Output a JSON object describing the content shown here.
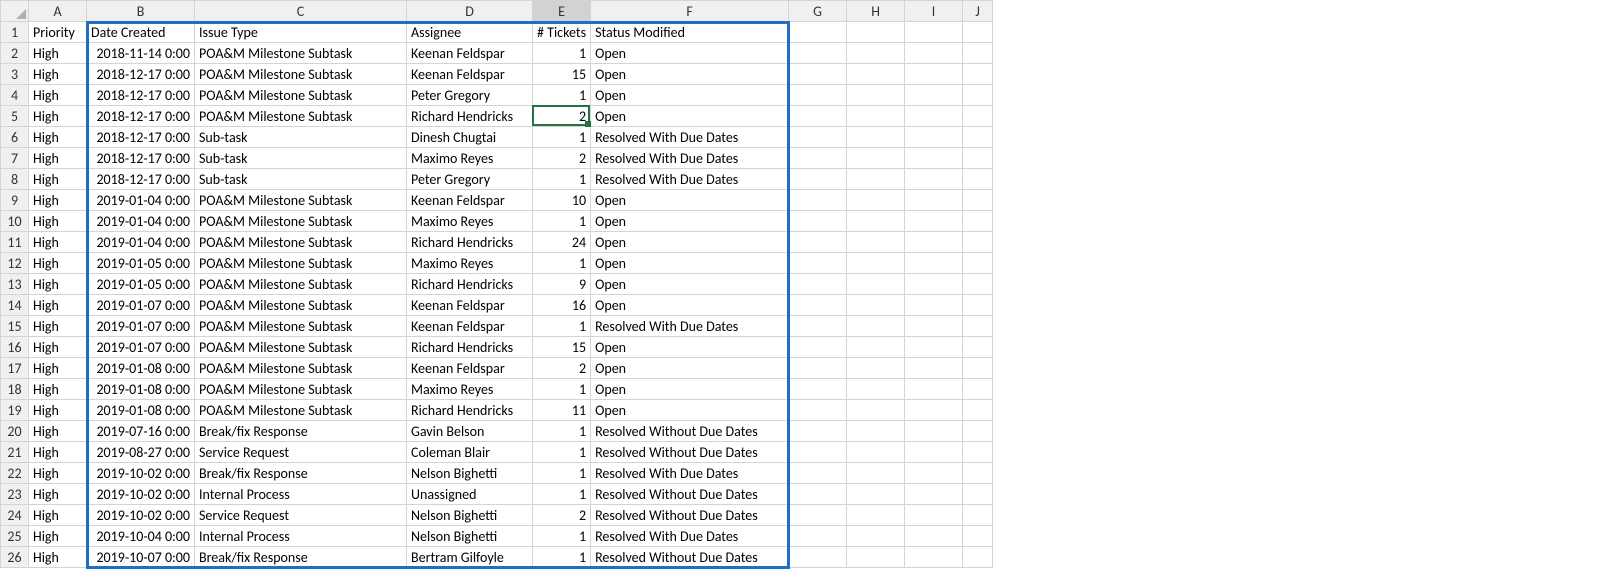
{
  "corner_label": "",
  "col_headers": [
    "A",
    "B",
    "C",
    "D",
    "E",
    "F",
    "G",
    "H",
    "I",
    "J"
  ],
  "row_headers": [
    "1",
    "2",
    "3",
    "4",
    "5",
    "6",
    "7",
    "8",
    "9",
    "10",
    "11",
    "12",
    "13",
    "14",
    "15",
    "16",
    "17",
    "18",
    "19",
    "20",
    "21",
    "22",
    "23",
    "24",
    "25",
    "26"
  ],
  "headers": {
    "priority": "Priority",
    "date_created": "Date Created",
    "issue_type": "Issue Type",
    "assignee": "Assignee",
    "tickets": "# Tickets",
    "status": "Status Modified"
  },
  "rows": [
    {
      "priority": "High",
      "date": "2018-11-14 0:00",
      "type": "POA&M Milestone Subtask",
      "assignee": "Keenan Feldspar",
      "tickets": "1",
      "status": "Open"
    },
    {
      "priority": "High",
      "date": "2018-12-17 0:00",
      "type": "POA&M Milestone Subtask",
      "assignee": "Keenan Feldspar",
      "tickets": "15",
      "status": "Open"
    },
    {
      "priority": "High",
      "date": "2018-12-17 0:00",
      "type": "POA&M Milestone Subtask",
      "assignee": "Peter Gregory",
      "tickets": "1",
      "status": "Open"
    },
    {
      "priority": "High",
      "date": "2018-12-17 0:00",
      "type": "POA&M Milestone Subtask",
      "assignee": "Richard Hendricks",
      "tickets": "2",
      "status": "Open"
    },
    {
      "priority": "High",
      "date": "2018-12-17 0:00",
      "type": "Sub-task",
      "assignee": "Dinesh Chugtai",
      "tickets": "1",
      "status": "Resolved With Due Dates"
    },
    {
      "priority": "High",
      "date": "2018-12-17 0:00",
      "type": "Sub-task",
      "assignee": "Maximo Reyes",
      "tickets": "2",
      "status": "Resolved With Due Dates"
    },
    {
      "priority": "High",
      "date": "2018-12-17 0:00",
      "type": "Sub-task",
      "assignee": "Peter Gregory",
      "tickets": "1",
      "status": "Resolved With Due Dates"
    },
    {
      "priority": "High",
      "date": "2019-01-04 0:00",
      "type": "POA&M Milestone Subtask",
      "assignee": "Keenan Feldspar",
      "tickets": "10",
      "status": "Open"
    },
    {
      "priority": "High",
      "date": "2019-01-04 0:00",
      "type": "POA&M Milestone Subtask",
      "assignee": "Maximo Reyes",
      "tickets": "1",
      "status": "Open"
    },
    {
      "priority": "High",
      "date": "2019-01-04 0:00",
      "type": "POA&M Milestone Subtask",
      "assignee": "Richard Hendricks",
      "tickets": "24",
      "status": "Open"
    },
    {
      "priority": "High",
      "date": "2019-01-05 0:00",
      "type": "POA&M Milestone Subtask",
      "assignee": "Maximo Reyes",
      "tickets": "1",
      "status": "Open"
    },
    {
      "priority": "High",
      "date": "2019-01-05 0:00",
      "type": "POA&M Milestone Subtask",
      "assignee": "Richard Hendricks",
      "tickets": "9",
      "status": "Open"
    },
    {
      "priority": "High",
      "date": "2019-01-07 0:00",
      "type": "POA&M Milestone Subtask",
      "assignee": "Keenan Feldspar",
      "tickets": "16",
      "status": "Open"
    },
    {
      "priority": "High",
      "date": "2019-01-07 0:00",
      "type": "POA&M Milestone Subtask",
      "assignee": "Keenan Feldspar",
      "tickets": "1",
      "status": "Resolved With Due Dates"
    },
    {
      "priority": "High",
      "date": "2019-01-07 0:00",
      "type": "POA&M Milestone Subtask",
      "assignee": "Richard Hendricks",
      "tickets": "15",
      "status": "Open"
    },
    {
      "priority": "High",
      "date": "2019-01-08 0:00",
      "type": "POA&M Milestone Subtask",
      "assignee": "Keenan Feldspar",
      "tickets": "2",
      "status": "Open"
    },
    {
      "priority": "High",
      "date": "2019-01-08 0:00",
      "type": "POA&M Milestone Subtask",
      "assignee": "Maximo Reyes",
      "tickets": "1",
      "status": "Open"
    },
    {
      "priority": "High",
      "date": "2019-01-08 0:00",
      "type": "POA&M Milestone Subtask",
      "assignee": "Richard Hendricks",
      "tickets": "11",
      "status": "Open"
    },
    {
      "priority": "High",
      "date": "2019-07-16 0:00",
      "type": "Break/fix Response",
      "assignee": "Gavin Belson",
      "tickets": "1",
      "status": "Resolved Without Due Dates"
    },
    {
      "priority": "High",
      "date": "2019-08-27 0:00",
      "type": "Service Request",
      "assignee": "Coleman Blair",
      "tickets": "1",
      "status": "Resolved Without Due Dates"
    },
    {
      "priority": "High",
      "date": "2019-10-02 0:00",
      "type": "Break/fix Response",
      "assignee": "Nelson Bighetti",
      "tickets": "1",
      "status": "Resolved With Due Dates"
    },
    {
      "priority": "High",
      "date": "2019-10-02 0:00",
      "type": "Internal Process",
      "assignee": "Unassigned",
      "tickets": "1",
      "status": "Resolved Without Due Dates"
    },
    {
      "priority": "High",
      "date": "2019-10-02 0:00",
      "type": "Service Request",
      "assignee": "Nelson Bighetti",
      "tickets": "2",
      "status": "Resolved Without Due Dates"
    },
    {
      "priority": "High",
      "date": "2019-10-04 0:00",
      "type": "Internal Process",
      "assignee": "Nelson Bighetti",
      "tickets": "1",
      "status": "Resolved With Due Dates"
    },
    {
      "priority": "High",
      "date": "2019-10-07 0:00",
      "type": "Break/fix Response",
      "assignee": "Bertram Gilfoyle",
      "tickets": "1",
      "status": "Resolved Without Due Dates"
    }
  ],
  "active_cell": "E5",
  "highlight_range": "B1:F26",
  "colors": {
    "highlight_border": "#1f6fc4",
    "active_border": "#217346",
    "grid": "#d4d4d4",
    "header_bg": "#f0f0f0"
  }
}
